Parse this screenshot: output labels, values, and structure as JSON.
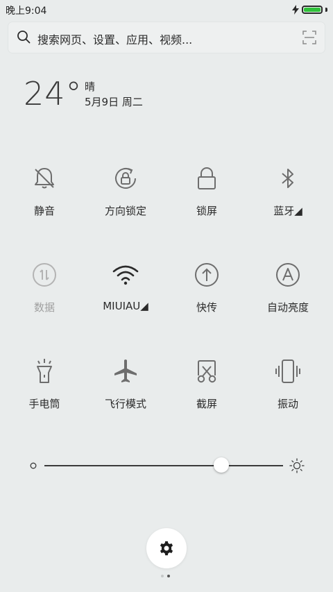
{
  "status": {
    "time": "晚上9:04",
    "battery_level": 1.0,
    "battery_color": "#2fc23a",
    "icons": [
      "charging-bolt-icon",
      "battery-icon"
    ]
  },
  "search": {
    "placeholder": "搜索网页、设置、应用、视频...",
    "left_icon": "search-icon",
    "right_icon": "scan-icon"
  },
  "weather": {
    "temperature": "24°",
    "condition": "晴",
    "date": "5月9日 周二"
  },
  "toggles": [
    {
      "label": "静音",
      "icon": "bell-off-icon",
      "active": false
    },
    {
      "label": "方向锁定",
      "icon": "rotation-lock-icon",
      "active": false
    },
    {
      "label": "锁屏",
      "icon": "lock-icon",
      "active": false
    },
    {
      "label": "蓝牙◢",
      "icon": "bluetooth-icon",
      "active": false
    },
    {
      "label": "数据",
      "icon": "mobile-data-icon",
      "active": false,
      "disabled": true
    },
    {
      "label": "MIUIAU◢",
      "icon": "wifi-icon",
      "active": true
    },
    {
      "label": "快传",
      "icon": "quick-transfer-icon",
      "active": false
    },
    {
      "label": "自动亮度",
      "icon": "auto-brightness-icon",
      "active": false
    },
    {
      "label": "手电筒",
      "icon": "flashlight-icon",
      "active": false
    },
    {
      "label": "飞行模式",
      "icon": "airplane-icon",
      "active": false
    },
    {
      "label": "截屏",
      "icon": "screenshot-icon",
      "active": false
    },
    {
      "label": "振动",
      "icon": "vibrate-icon",
      "active": false
    }
  ],
  "brightness": {
    "level": 0.74,
    "left_icon": "brightness-low-icon",
    "right_icon": "brightness-high-icon"
  },
  "settings": {
    "icon": "gear-icon"
  },
  "pager": {
    "count": 2,
    "active_index": 1
  },
  "colors": {
    "background": "#e9ecec",
    "icon": "#6d6d6d",
    "icon_disabled": "#b3b3b3",
    "icon_active": "#2a2a2a"
  }
}
